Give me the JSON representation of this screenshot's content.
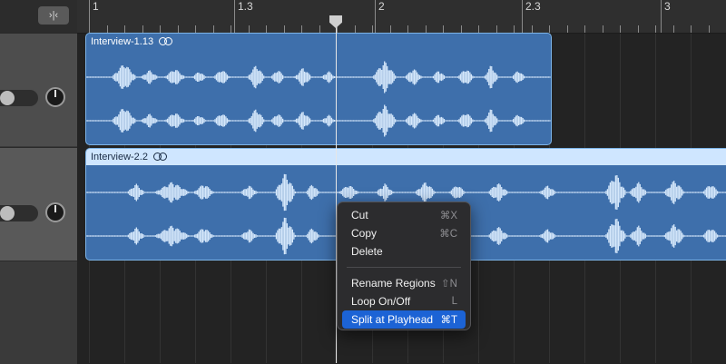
{
  "ruler": {
    "labels": [
      "1",
      "1.3",
      "2",
      "2.3",
      "3"
    ]
  },
  "toolbar": {
    "snap_icon": "catch-playhead-icon"
  },
  "regions": [
    {
      "name": "Interview-1.13",
      "icon": "loop-icon",
      "color": "#3e6fab"
    },
    {
      "name": "Interview-2.2",
      "icon": "loop-icon",
      "color": "#3e6fab",
      "header_color": "#cfe6ff"
    }
  ],
  "context_menu": {
    "items": [
      {
        "label": "Cut",
        "shortcut": "⌘X"
      },
      {
        "label": "Copy",
        "shortcut": "⌘C"
      },
      {
        "label": "Delete",
        "shortcut": ""
      },
      {
        "label": "Rename Regions",
        "shortcut": "⇧N"
      },
      {
        "label": "Loop On/Off",
        "shortcut": "L"
      },
      {
        "label": "Split at Playhead",
        "shortcut": "⌘T",
        "highlighted": true
      }
    ]
  },
  "colors": {
    "accent": "#1c63d5",
    "region": "#3e6fab",
    "waveform": "#d6e8fb"
  }
}
